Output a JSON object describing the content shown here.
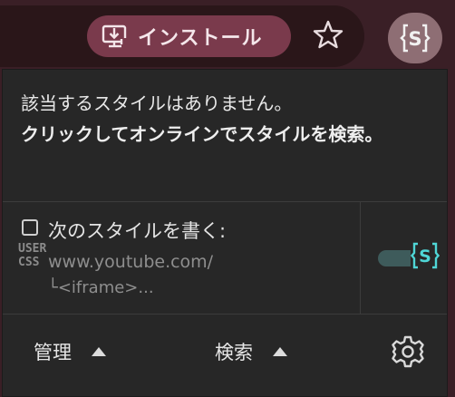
{
  "toolbar": {
    "install_label": "インストール",
    "install_icon": "install-download-icon",
    "bookmark_icon": "star-icon",
    "extension_icon": "stylus-s-icon",
    "colors": {
      "toolbar_bg": "#3a1f26",
      "install_bg": "#7a3a4c",
      "accent_teal": "#4fd6d6"
    }
  },
  "popup": {
    "message_line1": "該当するスタイルはありません。",
    "message_line2": "クリックしてオンラインでスタイルを検索。",
    "write_style_label": "次のスタイルを書く:",
    "usercss_line1": "USER",
    "usercss_line2": "CSS",
    "site": "www.youtube.com/",
    "frame_prefix": "└",
    "frame": "<iframe>...",
    "footer": {
      "manage_label": "管理",
      "search_label": "検索",
      "settings_icon": "gear-icon"
    }
  }
}
